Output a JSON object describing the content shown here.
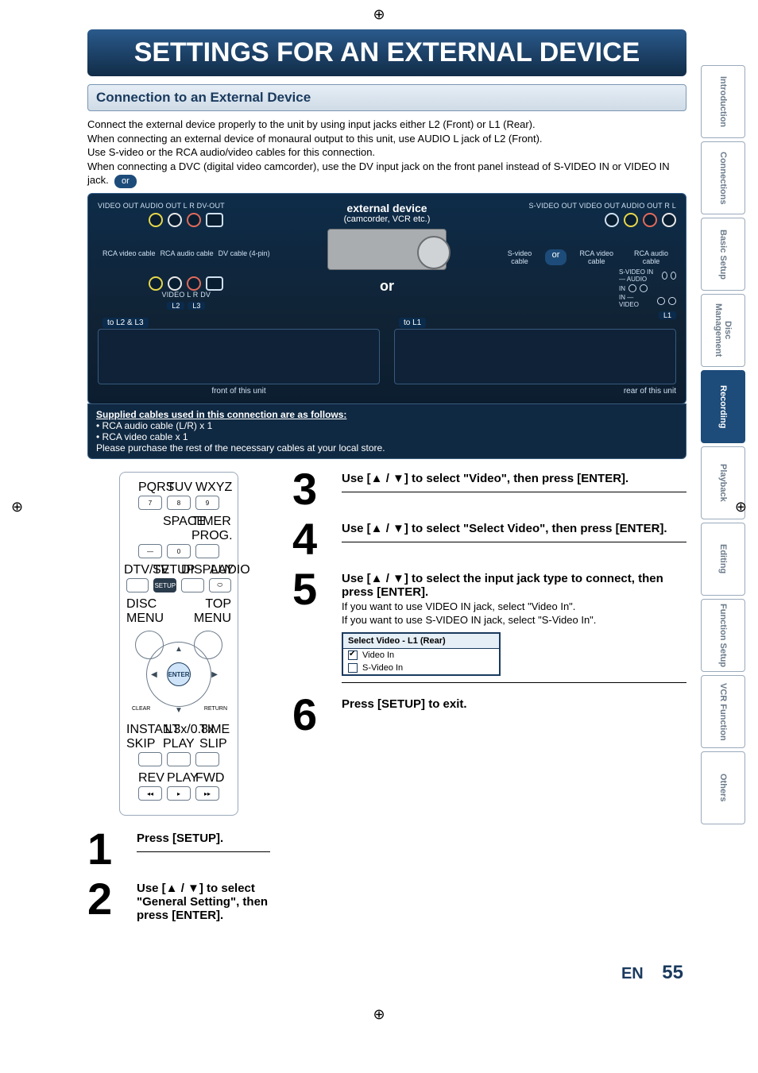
{
  "title": "SETTINGS FOR AN EXTERNAL DEVICE",
  "subhead": "Connection to an External Device",
  "intro": {
    "l1": "Connect the external device properly to the unit by using input jacks either L2 (Front) or L1 (Rear).",
    "l2": "When connecting an external device of monaural output to this unit, use AUDIO L jack of L2 (Front).",
    "l3": "Use S-video or the RCA audio/video cables for this connection.",
    "l4": "When connecting a DVC (digital video camcorder), use the DV input jack on the front panel instead of S-VIDEO IN or VIDEO IN jack."
  },
  "or_label": "or",
  "big_or": "or",
  "diagram": {
    "left": {
      "top_labels": "VIDEO OUT    AUDIO OUT L   R    DV-OUT",
      "cable1": "RCA video cable",
      "cable2": "RCA audio cable",
      "cable3": "DV cable (4-pin)",
      "row_labels": "VIDEO    L    R    DV",
      "lane_l2": "L2",
      "lane_l3": "L3",
      "conn_tag": "to L2 & L3",
      "caption": "front of this unit"
    },
    "center": {
      "title": "external device",
      "sub": "(camcorder, VCR etc.)"
    },
    "right": {
      "top_labels": "S-VIDEO OUT   VIDEO OUT   AUDIO OUT R   L",
      "cable1": "S-video cable",
      "cable2": "RCA video cable",
      "cable3": "RCA audio cable",
      "jacks_l1": "S-VIDEO   IN — AUDIO",
      "jacks_l2": "IN",
      "jacks_l3": "IN — VIDEO",
      "lane_l1": "L1",
      "conn_tag": "to L1",
      "caption": "rear of this unit"
    }
  },
  "supplied": {
    "hdr": "Supplied cables used in this connection are as follows:",
    "l1": "• RCA audio cable (L/R) x 1",
    "l2": "• RCA video cable x 1",
    "l3": "Please purchase the rest of the necessary cables at your local store."
  },
  "remote": {
    "r1": [
      "PQRS",
      "TUV",
      "WXYZ"
    ],
    "n1": [
      "7",
      "8",
      "9"
    ],
    "space": "SPACE",
    "zero": "0",
    "timer": "TIMER PROG.",
    "r2": [
      "DTV/TV",
      "SETUP",
      "DISPLAY",
      "AUDIO"
    ],
    "disc_menu": "DISC MENU",
    "top_menu": "TOP MENU",
    "enter": "ENTER",
    "clear": "CLEAR",
    "return": "RETURN",
    "r3": [
      "INSTANT SKIP",
      "1.3x/0.8x PLAY",
      "TIME SLIP"
    ],
    "r4": [
      "REV",
      "PLAY",
      "FWD"
    ]
  },
  "steps": {
    "s1": {
      "num": "1",
      "title": "Press [SETUP]."
    },
    "s2": {
      "num": "2",
      "title": "Use [▲ / ▼] to select \"General Setting\", then press [ENTER]."
    },
    "s3": {
      "num": "3",
      "title": "Use [▲ / ▼] to select \"Video\", then press [ENTER]."
    },
    "s4": {
      "num": "4",
      "title": "Use [▲ / ▼] to select \"Select Video\", then press [ENTER]."
    },
    "s5": {
      "num": "5",
      "title": "Use [▲ / ▼] to select the input jack type to connect, then press [ENTER].",
      "body1": "If you want to use VIDEO IN jack, select \"Video In\".",
      "body2": " If you want to use S-VIDEO IN jack, select \"S-Video In\"."
    },
    "s6": {
      "num": "6",
      "title": "Press [SETUP] to exit."
    }
  },
  "osd": {
    "head": "Select Video - L1 (Rear)",
    "opt1": "Video In",
    "opt2": "S-Video In"
  },
  "tabs": {
    "t1": "Introduction",
    "t2": "Connections",
    "t3": "Basic Setup",
    "t4": "Disc Management",
    "t5": "Recording",
    "t6": "Playback",
    "t7": "Editing",
    "t8": "Function Setup",
    "t9": "VCR Function",
    "t10": "Others"
  },
  "footer": {
    "lang": "EN",
    "page": "55"
  }
}
